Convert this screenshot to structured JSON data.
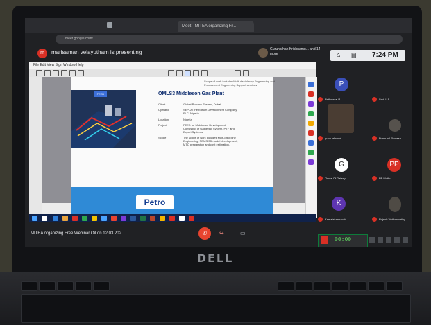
{
  "browser": {
    "tab_title": "Meet - MITEA organizing Fr...",
    "address": "meet.google.com/..."
  },
  "meet": {
    "presenter_banner": "marisaman velayutham is presenting",
    "presenter_initial": "m",
    "host_text": "Gurunathan Krishnamu... and 14 more",
    "clock": "7:24 PM",
    "meeting_name": "MITEA organizing Free Webinar Oil on 12.03.202...",
    "participants": [
      {
        "name": "Pathmaraj R",
        "initial": "P",
        "color": "#3a4fb8"
      },
      {
        "name": "Sruti L.S",
        "initial": "",
        "color": ""
      },
      {
        "name": "guna lakshmi",
        "initial": "",
        "color": ""
      },
      {
        "name": "Punnural Ramesh",
        "initial": "",
        "color": ""
      },
      {
        "name": "Times Of Galaxy",
        "initial": "G",
        "color": "#ffffff"
      },
      {
        "name": "PP Muthu",
        "initial": "PP",
        "color": "#d93025"
      },
      {
        "name": "Kamalakannan V",
        "initial": "K",
        "color": "#5e35b1"
      },
      {
        "name": "Rajesh Vadivumurthy",
        "initial": "",
        "color": ""
      }
    ]
  },
  "document": {
    "menu": "File  Edit  View  Sign  Window  Help",
    "top_snippet": "Scope of work includes Multi disciplinary Engineering and Procurement Engineering Support services",
    "project_title": "OMLS3 Middleson Gas Plant",
    "render_label": "FEED",
    "rows": [
      {
        "label": "Client",
        "value": "Global Process System, Dubai"
      },
      {
        "label": "Operator",
        "value": "SEPLAT Petroleum Development Company PLC, Nigeria"
      },
      {
        "label": "Location",
        "value": "Nigeria"
      },
      {
        "label": "Project",
        "value": "FEED for Midstream Development Consisting of Gathering System, PTF and Export Systems."
      },
      {
        "label": "Scope",
        "value": "The scope of work includes Multi-discipline Engineering, PDMS 3D model development, MTO preparation and cost estimation."
      }
    ],
    "logo_text": "Petro"
  },
  "laptop": {
    "brand": "DELL"
  },
  "widget": {
    "text": "00:00"
  }
}
